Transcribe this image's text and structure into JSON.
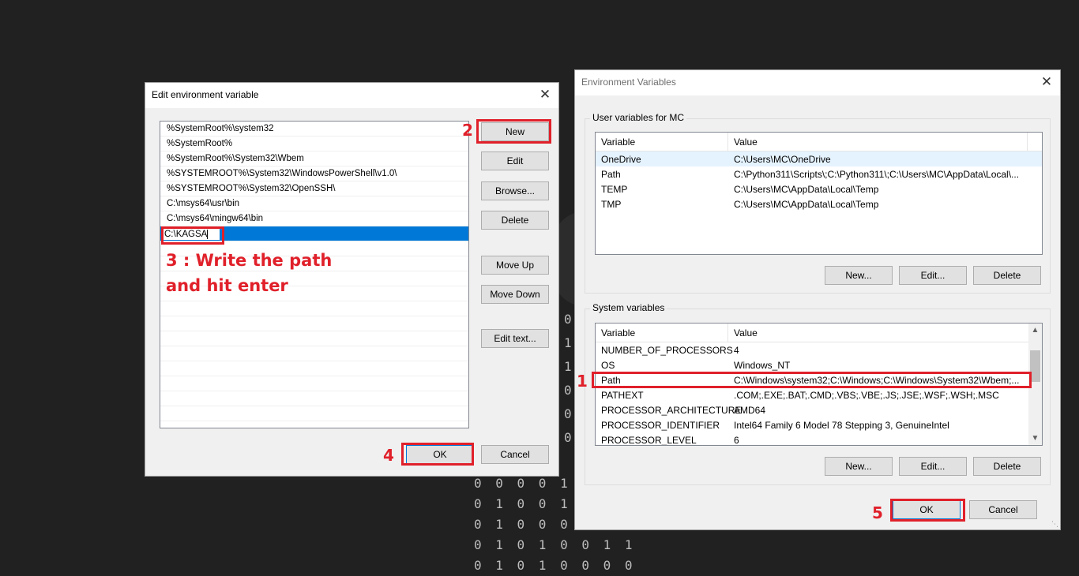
{
  "background": {
    "binary_rows": [
      "0 0 0 0 1 0",
      "0 1 0 0 1 0",
      "0 1 0 0 0 0 1",
      "0 1 0 1 0 0 1 1",
      "0 1 0 1 0 0 0 0"
    ],
    "binary_col": [
      "0",
      "1",
      "1",
      "0",
      "0",
      "0"
    ]
  },
  "edit_dialog": {
    "title": "Edit environment variable",
    "close_label": "✕",
    "entries": [
      "%SystemRoot%\\system32",
      "%SystemRoot%",
      "%SystemRoot%\\System32\\Wbem",
      "%SYSTEMROOT%\\System32\\WindowsPowerShell\\v1.0\\",
      "%SYSTEMROOT%\\System32\\OpenSSH\\",
      "C:\\msys64\\usr\\bin",
      "C:\\msys64\\mingw64\\bin"
    ],
    "editing_value": "C:\\KAGSA",
    "buttons": {
      "new": "New",
      "edit": "Edit",
      "browse": "Browse...",
      "delete": "Delete",
      "move_up": "Move Up",
      "move_down": "Move Down",
      "edit_text": "Edit text...",
      "ok": "OK",
      "cancel": "Cancel"
    }
  },
  "env_dialog": {
    "title": "Environment Variables",
    "close_label": "✕",
    "user_group_label": "User variables for MC",
    "system_group_label": "System variables",
    "col_variable": "Variable",
    "col_value": "Value",
    "user_vars": [
      {
        "name": "OneDrive",
        "value": "C:\\Users\\MC\\OneDrive"
      },
      {
        "name": "Path",
        "value": "C:\\Python311\\Scripts\\;C:\\Python311\\;C:\\Users\\MC\\AppData\\Local\\..."
      },
      {
        "name": "TEMP",
        "value": "C:\\Users\\MC\\AppData\\Local\\Temp"
      },
      {
        "name": "TMP",
        "value": "C:\\Users\\MC\\AppData\\Local\\Temp"
      }
    ],
    "system_vars": [
      {
        "name": "NUMBER_OF_PROCESSORS",
        "value": "4"
      },
      {
        "name": "OS",
        "value": "Windows_NT"
      },
      {
        "name": "Path",
        "value": "C:\\Windows\\system32;C:\\Windows;C:\\Windows\\System32\\Wbem;..."
      },
      {
        "name": "PATHEXT",
        "value": ".COM;.EXE;.BAT;.CMD;.VBS;.VBE;.JS;.JSE;.WSF;.WSH;.MSC"
      },
      {
        "name": "PROCESSOR_ARCHITECTURE",
        "value": "AMD64"
      },
      {
        "name": "PROCESSOR_IDENTIFIER",
        "value": "Intel64 Family 6 Model 78 Stepping 3, GenuineIntel"
      },
      {
        "name": "PROCESSOR_LEVEL",
        "value": "6"
      }
    ],
    "buttons": {
      "user_new": "New...",
      "user_edit": "Edit...",
      "user_delete": "Delete",
      "sys_new": "New...",
      "sys_edit": "Edit...",
      "sys_delete": "Delete",
      "ok": "OK",
      "cancel": "Cancel"
    }
  },
  "annotations": {
    "step1": "1",
    "step2": "2",
    "step3_line1": "3 : Write the path",
    "step3_line2": "and hit enter",
    "step4": "4",
    "step5": "5",
    "color": "#e0202a"
  }
}
